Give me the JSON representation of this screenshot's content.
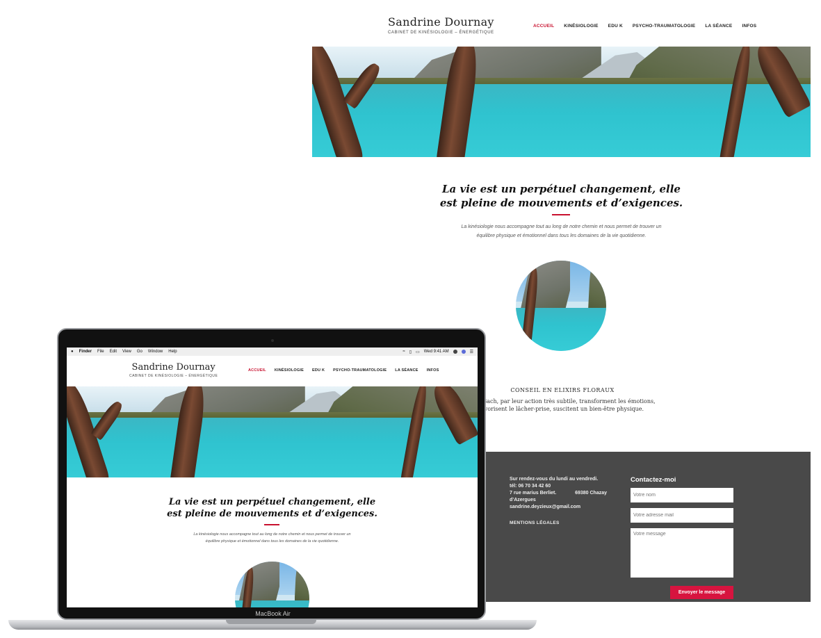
{
  "site": {
    "brand_name": "Sandrine Dournay",
    "brand_tagline": "CABINET DE KINÉSIOLOGIE – ÉNERGÉTIQUE",
    "nav": [
      "ACCUEIL",
      "KINÉSIOLOGIE",
      "EDU K",
      "PSYCHO-TRAUMATOLOGIE",
      "LA SÉANCE",
      "INFOS"
    ],
    "active_nav": "ACCUEIL",
    "headline_line1": "La vie est un perpétuel changement, elle",
    "headline_line2": "est pleine de mouvements et d’exigences.",
    "intro_line1": "La kinésiologie nous accompagne tout au long de notre chemin et nous permet de trouver un",
    "intro_line2": "équilibre physique et émotionnel dans tous les domaines de la vie quotidienne.",
    "conseil_title": "CONSEIL EN ELIXIRS FLORAUX",
    "conseil_line1": "s de Bach, par leur action très subtile, transforment les émotions,",
    "conseil_line2": "avorisent le lâcher-prise, suscitent un bien-être physique."
  },
  "footer": {
    "hours": "Sur rendez-vous du lundi au vendredi.",
    "phone": "tél: 06 70 34 42 60",
    "street": "7 rue marius Berliet.",
    "postcode": "69380 Chazay",
    "town": "d’Azergues",
    "email": "sandrine.deyzieux@gmail.com",
    "legal": "MENTIONS LÉGALES",
    "contact_title": "Contactez-moi",
    "name_placeholder": "Votre nom",
    "email_placeholder": "Votre adresse mail",
    "message_placeholder": "Votre message",
    "send_label": "Envoyer le message"
  },
  "mac": {
    "menubar": [
      "Finder",
      "File",
      "Edit",
      "View",
      "Go",
      "Window",
      "Help"
    ],
    "clock": "Wed 9:41 AM",
    "model_label": "MacBook Air"
  },
  "colors": {
    "accent": "#c8102e",
    "footer_bg": "#494949",
    "button": "#d7143f"
  }
}
